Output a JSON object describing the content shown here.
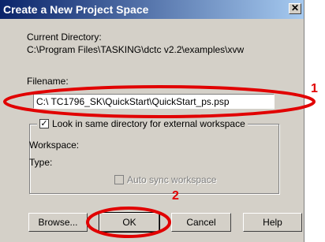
{
  "window": {
    "title": "Create a New Project Space",
    "close_glyph": "✕"
  },
  "current_directory": {
    "label": "Current Directory:",
    "path": "C:\\Program Files\\TASKING\\dctc v2.2\\examples\\xvw"
  },
  "filename": {
    "label": "Filename:",
    "value": "C:\\ TC1796_SK\\QuickStart\\QuickStart_ps.psp"
  },
  "workspace_group": {
    "look_same_dir_label": "Look in same directory for external workspace",
    "look_same_dir_checked": true,
    "workspace_label": "Workspace:",
    "type_label": "Type:",
    "auto_sync_label": "Auto sync workspace",
    "auto_sync_checked": false,
    "auto_sync_enabled": false
  },
  "buttons": {
    "browse": "Browse...",
    "ok": "OK",
    "cancel": "Cancel",
    "help": "Help"
  },
  "annotations": {
    "callout_1": "1",
    "callout_2": "2",
    "highlight_color": "#e10000"
  }
}
